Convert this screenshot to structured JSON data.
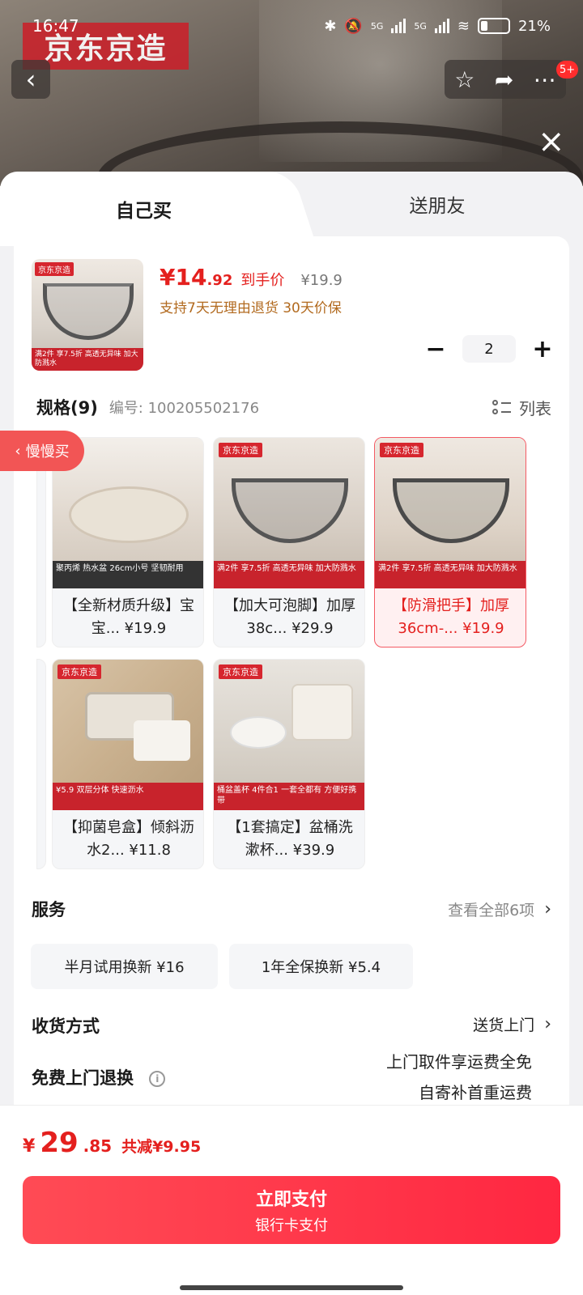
{
  "status": {
    "time": "16:47",
    "net1": "5G",
    "net2": "5G",
    "battery": "21%"
  },
  "brand": {
    "logo_text": "京东京造"
  },
  "nav": {
    "badge": "5+"
  },
  "tabs": {
    "self": "自己买",
    "friend": "送朋友"
  },
  "product": {
    "price_int": "14",
    "price_dec": ".92",
    "price_label": "到手价",
    "original_price": "¥19.9",
    "policy": "支持7天无理由退货 30天价保",
    "quantity": "2",
    "thumb_tag": "京东京造",
    "thumb_strip": "满2件 享7.5折   高透无异味 加大防溅水"
  },
  "spec": {
    "title": "规格(9)",
    "number": "编号: 100205502176",
    "list_label": "列表"
  },
  "slow_buy": "慢慢买",
  "variants": [
    {
      "tag": "",
      "strip": "聚丙烯 热水盆   26cm小号 坚韧耐用",
      "name": "【全新材质升级】宝宝... ¥19.9"
    },
    {
      "tag": "京东京造",
      "strip": "满2件 享7.5折   高透无异味 加大防溅水",
      "name": "【加大可泡脚】加厚38c... ¥29.9"
    },
    {
      "tag": "京东京造",
      "strip": "满2件 享7.5折   高透无异味 加大防溅水",
      "name": "【防滑把手】加厚36cm-... ¥19.9"
    },
    {
      "tag": "京东京造",
      "strip": "¥5.9   双层分体 快速沥水",
      "name": "【抑菌皂盒】倾斜沥水2... ¥11.8"
    },
    {
      "tag": "京东京造",
      "strip": "桶盆盖杯 4件合1   一套全都有 方便好携带",
      "name": "【1套搞定】盆桶洗漱杯... ¥39.9"
    }
  ],
  "service": {
    "title": "服务",
    "more": "查看全部6项",
    "options": [
      "半月试用换新 ¥16",
      "1年全保换新 ¥5.4"
    ]
  },
  "delivery": {
    "title": "收货方式",
    "value": "送货上门"
  },
  "returns": {
    "title": "免费上门退换",
    "line1": "上门取件享运费全免",
    "line2": "自寄补首重运费"
  },
  "footer": {
    "currency": "¥",
    "total_int": "29",
    "total_dec": ".85",
    "saving": "共减¥9.95",
    "pay_label": "立即支付",
    "pay_method": "银行卡支付"
  }
}
